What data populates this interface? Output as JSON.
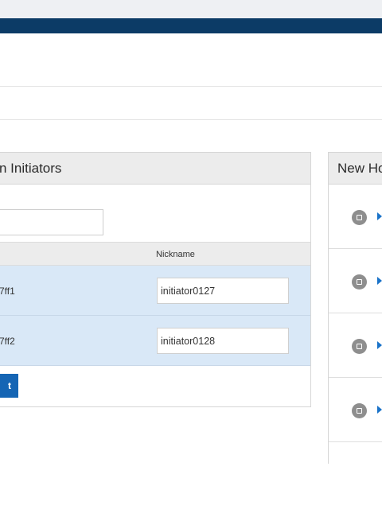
{
  "left_panel": {
    "title": "n Initiators",
    "columns": {
      "nickname": "Nickname"
    },
    "rows": [
      {
        "wwn_suffix": "7ff1",
        "nickname": "initiator0127"
      },
      {
        "wwn_suffix": "7ff2",
        "nickname": "initiator0128"
      }
    ],
    "primary_button_label": "t"
  },
  "right_panel": {
    "title": "New Ho",
    "items": [
      {},
      {},
      {},
      {}
    ]
  },
  "colors": {
    "navy_bar": "#0c3b66",
    "row_selected": "#d9e8f7",
    "primary_button": "#1565b4",
    "arrow": "#1a73c9"
  }
}
